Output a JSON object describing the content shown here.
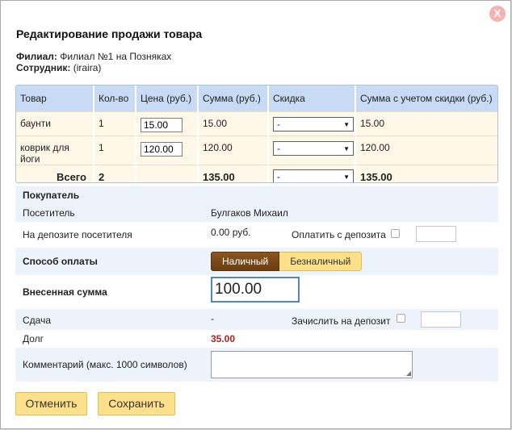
{
  "dialog": {
    "title": "Редактирование продажи товара",
    "close_label": "X",
    "branch_label": "Филиал:",
    "branch_value": "Филиал №1 на Позняках",
    "employee_label": "Сотрудник:",
    "employee_value": "(iraira)"
  },
  "goods_table": {
    "headers": [
      "Товар",
      "Кол-во",
      "Цена (руб.)",
      "Сумма (руб.)",
      "Скидка",
      "Сумма с учетом скидки (руб.)"
    ],
    "rows": [
      {
        "item": "баунти",
        "qty": "1",
        "price": "15.00",
        "sum": "15.00",
        "discount": "-",
        "sum_discount": "15.00"
      },
      {
        "item": "коврик для йоги",
        "qty": "1",
        "price": "120.00",
        "sum": "120.00",
        "discount": "-",
        "sum_discount": "120.00"
      }
    ],
    "total": {
      "label": "Всего",
      "qty": "2",
      "sum": "135.00",
      "discount": "-",
      "sum_discount": "135.00"
    }
  },
  "buyer": {
    "section_title": "Покупатель",
    "visitor_label": "Посетитель",
    "visitor_value": "Булгаков Михаил",
    "deposit_label": "На депозите посетителя",
    "deposit_value": "0.00 руб.",
    "pay_deposit_label": "Оплатить с депозита"
  },
  "payment": {
    "method_label": "Способ оплаты",
    "method_cash": "Наличный",
    "method_cashless": "Безналичный",
    "amount_label": "Внесенная сумма",
    "amount_value": "100.00",
    "change_label": "Сдача",
    "change_value": "-",
    "credit_deposit_label": "Зачислить на депозит",
    "debt_label": "Долг",
    "debt_value": "35.00",
    "comment_label": "Комментарий (макс. 1000 символов)"
  },
  "actions": {
    "cancel_label": "Отменить",
    "save_label": "Сохранить"
  },
  "colors": {
    "accent_yellow": "#ffe08a",
    "active_brown": "#7a4816",
    "header_blue": "#c7dcf4",
    "debt_red": "#b02020"
  }
}
